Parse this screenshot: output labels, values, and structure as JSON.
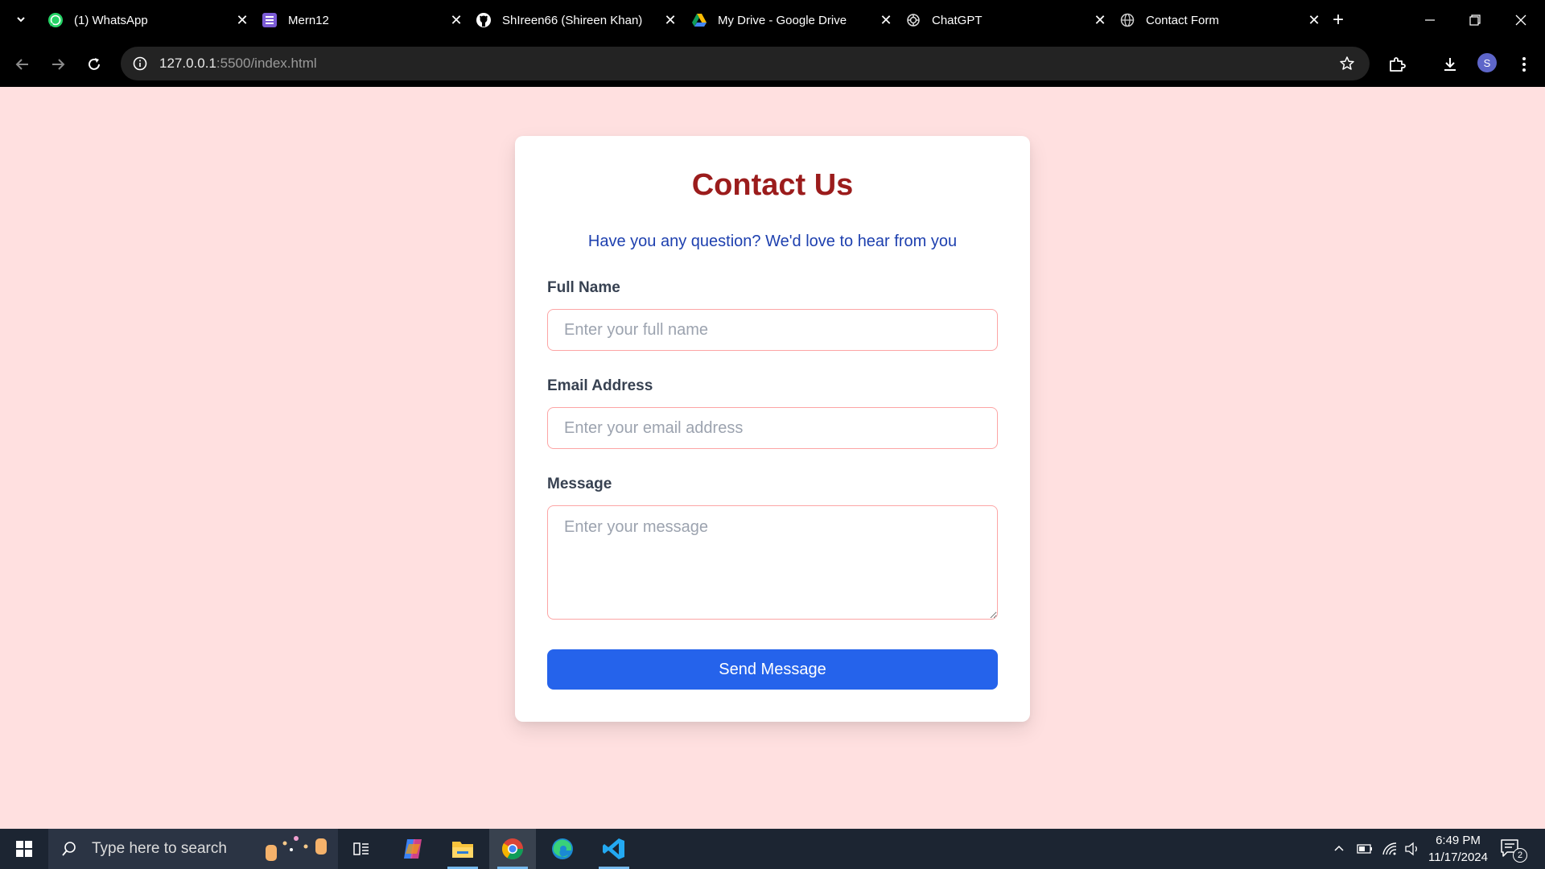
{
  "browser": {
    "tabs": [
      {
        "label": "(1) WhatsApp",
        "icon": "whatsapp-icon"
      },
      {
        "label": "Mern12",
        "icon": "list-icon"
      },
      {
        "label": "ShIreen66 (Shireen Khan)",
        "icon": "github-icon"
      },
      {
        "label": "My Drive - Google Drive",
        "icon": "google-drive-icon"
      },
      {
        "label": "ChatGPT",
        "icon": "chatgpt-icon"
      },
      {
        "label": "Contact Form",
        "icon": "globe-icon"
      }
    ],
    "url_host": "127.0.0.1",
    "url_rest": ":5500/index.html",
    "profile_initial": "S"
  },
  "form": {
    "title": "Contact Us",
    "subtitle": "Have you any question? We'd love to hear from you",
    "name_label": "Full Name",
    "name_placeholder": "Enter your full name",
    "email_label": "Email Address",
    "email_placeholder": "Enter your email address",
    "message_label": "Message",
    "message_placeholder": "Enter your message",
    "submit_label": "Send Message"
  },
  "taskbar": {
    "search_placeholder": "Type here to search",
    "time": "6:49 PM",
    "date": "11/17/2024",
    "notification_count": "2"
  },
  "colors": {
    "page_bg": "#ffe0e0",
    "title": "#9b1c1c",
    "subtitle": "#1e40af",
    "button": "#2563eb",
    "field_border": "#fca5a5"
  }
}
